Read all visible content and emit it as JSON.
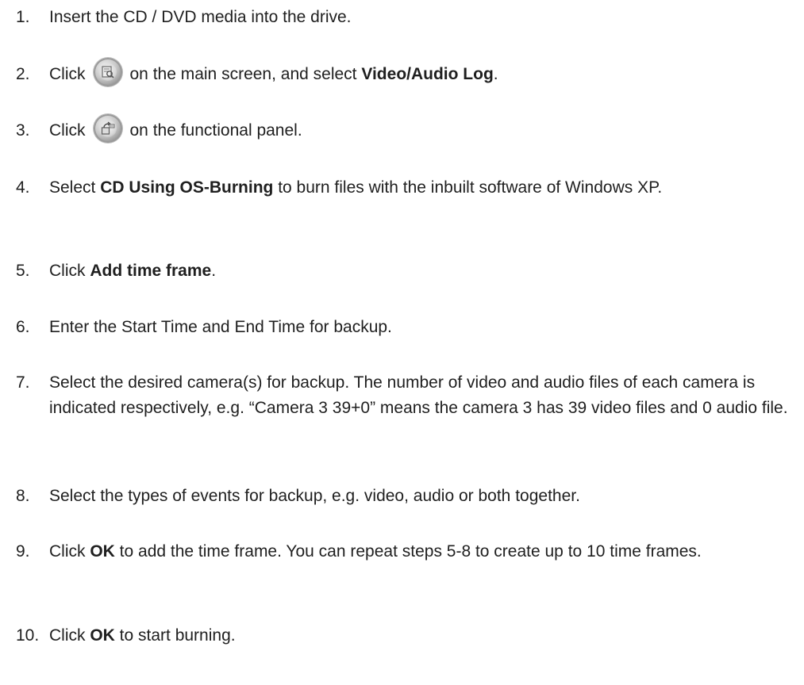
{
  "steps": [
    {
      "num": "1.",
      "text": "Insert the CD / DVD media into the drive."
    },
    {
      "num": "2.",
      "pre": "Click",
      "icon": "log-search-icon",
      "post": "on the main screen, and select ",
      "bold": "Video/Audio Log",
      "tail": "."
    },
    {
      "num": "3.",
      "pre": "Click",
      "icon": "burn-export-icon",
      "post": "on the functional panel."
    },
    {
      "num": "4.",
      "pre": "Select ",
      "bold": "CD Using OS-Burning",
      "post": " to burn files with the inbuilt software of Windows XP."
    },
    {
      "num": "5.",
      "pre": "Click ",
      "bold": "Add time frame",
      "tail": "."
    },
    {
      "num": "6.",
      "text": "Enter the Start Time and End Time for backup."
    },
    {
      "num": "7.",
      "text": "Select the desired camera(s) for backup. The number of video and audio files of each camera is indicated respectively, e.g. “Camera 3 39+0” means the camera 3 has 39 video files and 0 audio file."
    },
    {
      "num": "8.",
      "text": "Select the types of events for backup, e.g. video, audio or both together."
    },
    {
      "num": "9.",
      "pre": "Click ",
      "bold": "OK",
      "post": " to add the time frame. You can repeat steps 5-8 to create up to 10 time frames."
    },
    {
      "num": "10.",
      "pre": "Click ",
      "bold": "OK",
      "post": " to start burning."
    }
  ]
}
